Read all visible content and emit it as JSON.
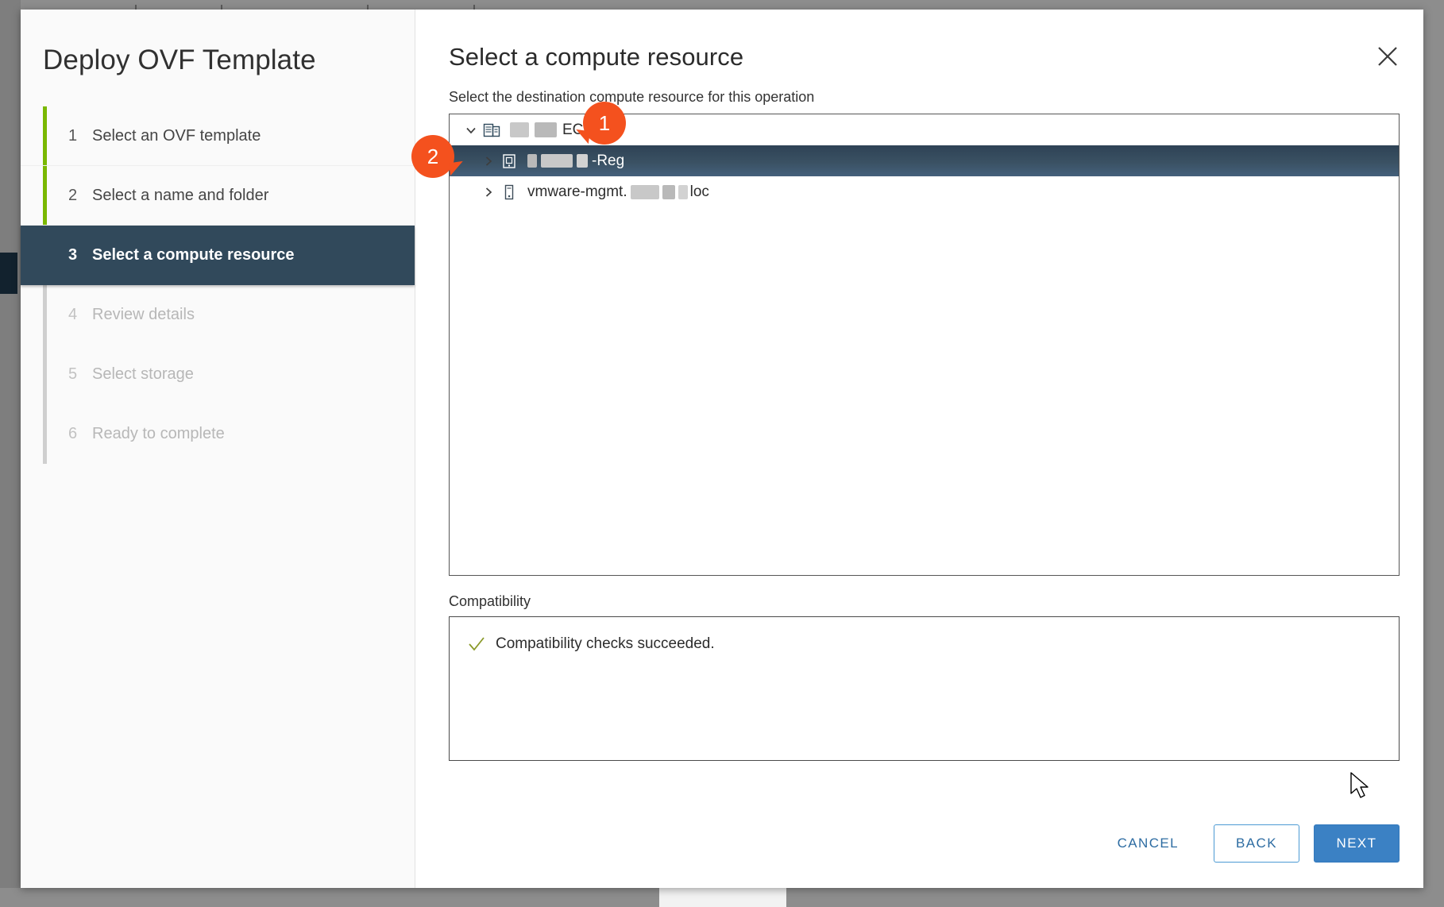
{
  "window": {
    "title": "Deploy OVF Template",
    "close_icon": "close-icon"
  },
  "wizard": {
    "steps": [
      {
        "num": "1",
        "label": "Select an OVF template",
        "state": "done"
      },
      {
        "num": "2",
        "label": "Select a name and folder",
        "state": "done"
      },
      {
        "num": "3",
        "label": "Select a compute resource",
        "state": "active"
      },
      {
        "num": "4",
        "label": "Review details",
        "state": "upcoming"
      },
      {
        "num": "5",
        "label": "Select storage",
        "state": "upcoming"
      },
      {
        "num": "6",
        "label": "Ready to complete",
        "state": "upcoming"
      }
    ],
    "rail_done_color": "#7ab800",
    "active_bg": "#31495b"
  },
  "page": {
    "title": "Select a compute resource",
    "subtitle": "Select the destination compute resource for this operation"
  },
  "tree": {
    "rows": [
      {
        "twisty": "chevron-down-icon",
        "icon": "datacenter-icon",
        "label_suffix": "ECOD1",
        "redacted": true,
        "selected": false,
        "indent": 0
      },
      {
        "twisty": "chevron-right-icon",
        "icon": "cluster-icon",
        "label_suffix": "-Reg",
        "redacted": true,
        "selected": true,
        "indent": 1
      },
      {
        "twisty": "chevron-right-icon",
        "icon": "host-icon",
        "label_prefix": "vmware-mgmt.",
        "label_suffix": "loc",
        "redacted": true,
        "selected": false,
        "indent": 1
      }
    ]
  },
  "compatibility": {
    "label": "Compatibility",
    "message": "Compatibility checks succeeded.",
    "status_icon": "check-icon",
    "status_color": "#8a9a2a"
  },
  "footer": {
    "cancel_label": "CANCEL",
    "back_label": "BACK",
    "next_label": "NEXT",
    "primary_color": "#3b81c4",
    "link_color": "#2d6ca2"
  },
  "callouts": [
    {
      "number": "1",
      "color": "#f4511e"
    },
    {
      "number": "2",
      "color": "#f4511e"
    }
  ]
}
